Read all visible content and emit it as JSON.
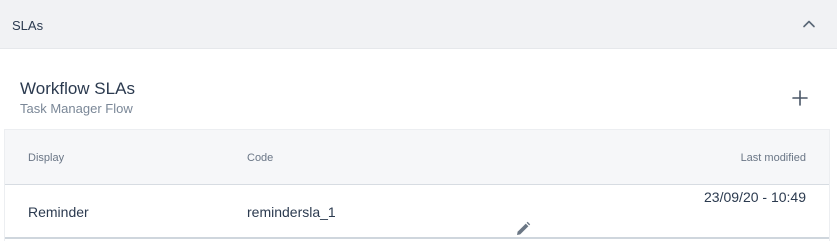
{
  "section": {
    "title": "SLAs",
    "collapse_icon": "chevron-up-icon"
  },
  "card": {
    "title": "Workflow SLAs",
    "subtitle": "Task Manager Flow",
    "add_icon": "plus-icon"
  },
  "table": {
    "columns": {
      "display": "Display",
      "code": "Code",
      "last_modified": "Last modified"
    },
    "rows": [
      {
        "display": "Reminder",
        "code": "remindersla_1",
        "last_modified": "23/09/20 - 10:49",
        "action_icon": "pencil-edit-icon"
      }
    ]
  },
  "colors": {
    "header_bg": "#f1f2f4",
    "text_primary": "#2b3a4f",
    "text_secondary": "#7a8797"
  }
}
